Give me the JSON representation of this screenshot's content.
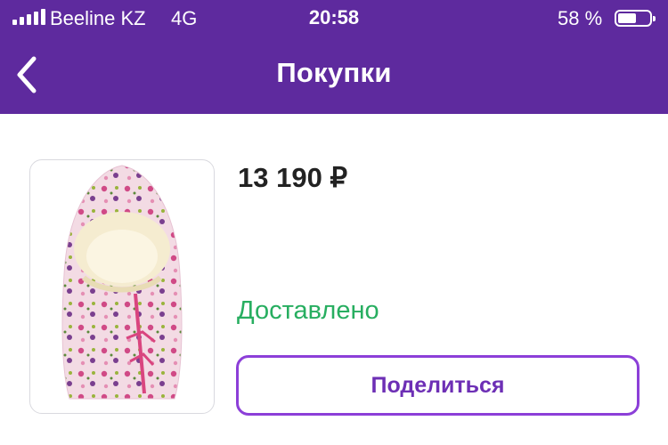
{
  "status_bar": {
    "carrier": "Beeline KZ",
    "network": "4G",
    "time": "20:58",
    "battery_percent_label": "58 %",
    "battery_level": 0.58
  },
  "nav": {
    "title": "Покупки",
    "back_icon": "chevron-left-icon"
  },
  "purchase": {
    "price": "13 190 ₽",
    "status": "Доставлено",
    "share_label": "Поделиться",
    "image_icon": "baby-sleeping-bag-photo"
  },
  "colors": {
    "header_bg": "#5e2a9e",
    "status_green": "#27ae60",
    "accent_purple": "#8c3fd8",
    "share_text": "#6d2fb5"
  }
}
